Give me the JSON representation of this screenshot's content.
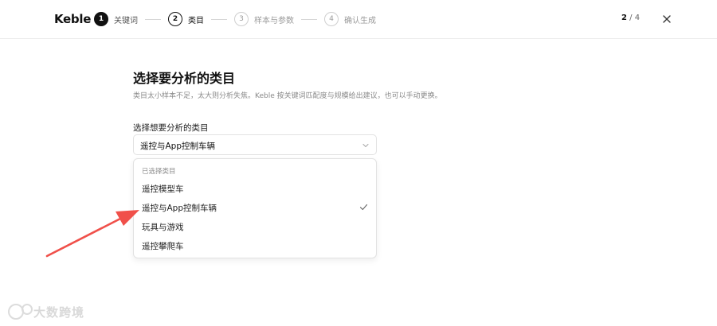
{
  "header": {
    "logo": "Keble",
    "steps": [
      {
        "num": "1",
        "label": "关键词",
        "state": "done"
      },
      {
        "num": "2",
        "label": "类目",
        "state": "active"
      },
      {
        "num": "3",
        "label": "样本与参数",
        "state": "todo"
      },
      {
        "num": "4",
        "label": "确认生成",
        "state": "todo"
      }
    ],
    "counter_current": "2",
    "counter_total": " / 4",
    "close_icon": "close-icon"
  },
  "main": {
    "title": "选择要分析的类目",
    "subtitle": "类目太小样本不足，太大则分析失焦。Keble 按关键词匹配度与规模给出建议，也可以手动更换。",
    "field_label": "选择想要分析的类目",
    "selected_value": "遥控与App控制车辆",
    "dropdown": {
      "group_label": "已选择类目",
      "options": [
        {
          "label": "遥控模型车",
          "selected": false
        },
        {
          "label": "遥控与App控制车辆",
          "selected": true
        },
        {
          "label": "玩具与游戏",
          "selected": false
        },
        {
          "label": "遥控攀爬车",
          "selected": false
        }
      ]
    }
  },
  "annotation": {
    "arrow_color": "#f0504a"
  },
  "watermark": {
    "text": "大数跨境",
    "color": "#d9d9d9"
  },
  "colors": {
    "primary": "#111111",
    "muted": "#8a8a8a",
    "border": "#e2e2e2"
  }
}
